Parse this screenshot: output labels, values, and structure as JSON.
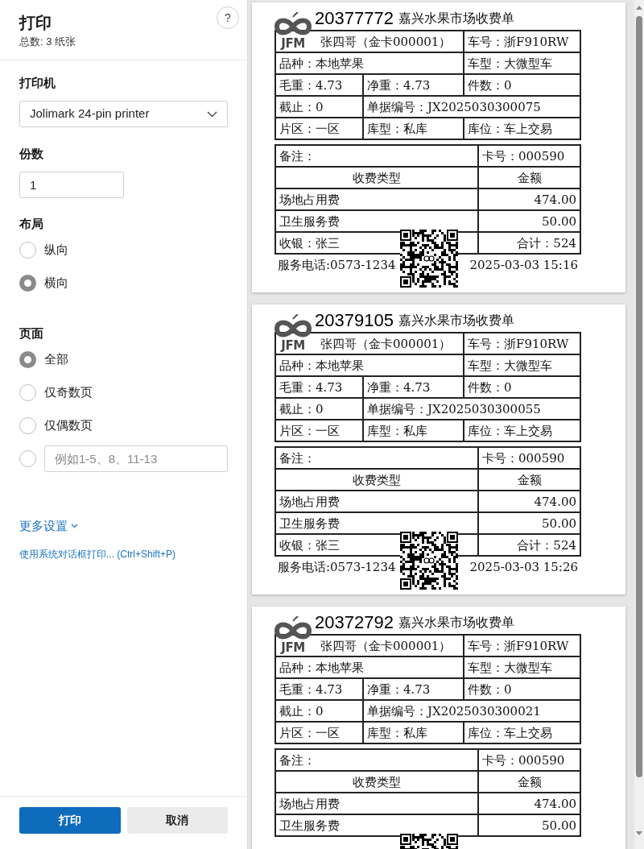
{
  "panel": {
    "title": "打印",
    "subtitle": "总数: 3 纸张",
    "help": "?",
    "printer": {
      "label": "打印机",
      "value": "Jolimark 24-pin printer"
    },
    "copies": {
      "label": "份数",
      "value": "1"
    },
    "layout": {
      "label": "布局",
      "options": [
        {
          "label": "纵向",
          "selected": false
        },
        {
          "label": "横向",
          "selected": true
        }
      ]
    },
    "pages": {
      "label": "页面",
      "options": [
        {
          "kind": "label",
          "label": "全部",
          "selected": true
        },
        {
          "kind": "label",
          "label": "仅奇数页",
          "selected": false
        },
        {
          "kind": "label",
          "label": "仅偶数页",
          "selected": false
        },
        {
          "kind": "field",
          "placeholder": "例如1-5、8、11-13",
          "selected": false
        }
      ]
    },
    "more_settings": "更多设置",
    "system_dialog": "使用系统对话框打印... (Ctrl+Shift+P)",
    "buttons": [
      {
        "kind": "primary",
        "label": "打印"
      },
      {
        "kind": "secondary",
        "label": "取消"
      }
    ]
  },
  "preview": [
    {
      "title": "嘉兴水果市场收费单",
      "logo_text": "JFM",
      "serial": "20377772",
      "customer": "张四哥（金卡000001）",
      "plate": "车号：浙F910RW",
      "variety": "品种：本地苹果",
      "vehicle_type": "车型：大微型车",
      "gross": "毛重：4.73",
      "net": "净重：4.73",
      "pieces": "件数：0",
      "cutoff": "截止：0",
      "doc_no": "单据编号：JX2025030300075",
      "zone": "片区：一区",
      "storage_type": "库型：私库",
      "storage_position": "库位：车上交易",
      "remark": "备注：",
      "card_no": "卡号：000590",
      "columns": [
        "收费类型",
        "金额"
      ],
      "items": [
        {
          "name": "场地占用费",
          "amount": "474.00"
        },
        {
          "name": "卫生服务费",
          "amount": "50.00"
        }
      ],
      "cashier": "收银：张三",
      "total": "合计：524",
      "phone": "服务电话:0573-1234",
      "datetime": "2025-03-03 15:16"
    },
    {
      "title": "嘉兴水果市场收费单",
      "logo_text": "JFM",
      "serial": "20379105",
      "customer": "张四哥（金卡000001）",
      "plate": "车号：浙F910RW",
      "variety": "品种：本地苹果",
      "vehicle_type": "车型：大微型车",
      "gross": "毛重：4.73",
      "net": "净重：4.73",
      "pieces": "件数：0",
      "cutoff": "截止：0",
      "doc_no": "单据编号：JX2025030300055",
      "zone": "片区：一区",
      "storage_type": "库型：私库",
      "storage_position": "库位：车上交易",
      "remark": "备注：",
      "card_no": "卡号：000590",
      "columns": [
        "收费类型",
        "金额"
      ],
      "items": [
        {
          "name": "场地占用费",
          "amount": "474.00"
        },
        {
          "name": "卫生服务费",
          "amount": "50.00"
        }
      ],
      "cashier": "收银：张三",
      "total": "合计：524",
      "phone": "服务电话:0573-1234",
      "datetime": "2025-03-03 15:26"
    },
    {
      "title": "嘉兴水果市场收费单",
      "logo_text": "JFM",
      "serial": "20372792",
      "customer": "张四哥（金卡000001）",
      "plate": "车号：浙F910RW",
      "variety": "品种：本地苹果",
      "vehicle_type": "车型：大微型车",
      "gross": "毛重：4.73",
      "net": "净重：4.73",
      "pieces": "件数：0",
      "cutoff": "截止：0",
      "doc_no": "单据编号：JX2025030300021",
      "zone": "片区：一区",
      "storage_type": "库型：私库",
      "storage_position": "库位：车上交易",
      "remark": "备注：",
      "card_no": "卡号：000590",
      "columns": [
        "收费类型",
        "金额"
      ],
      "items": [
        {
          "name": "场地占用费",
          "amount": "474.00"
        },
        {
          "name": "卫生服务费",
          "amount": "50.00"
        }
      ]
    }
  ]
}
